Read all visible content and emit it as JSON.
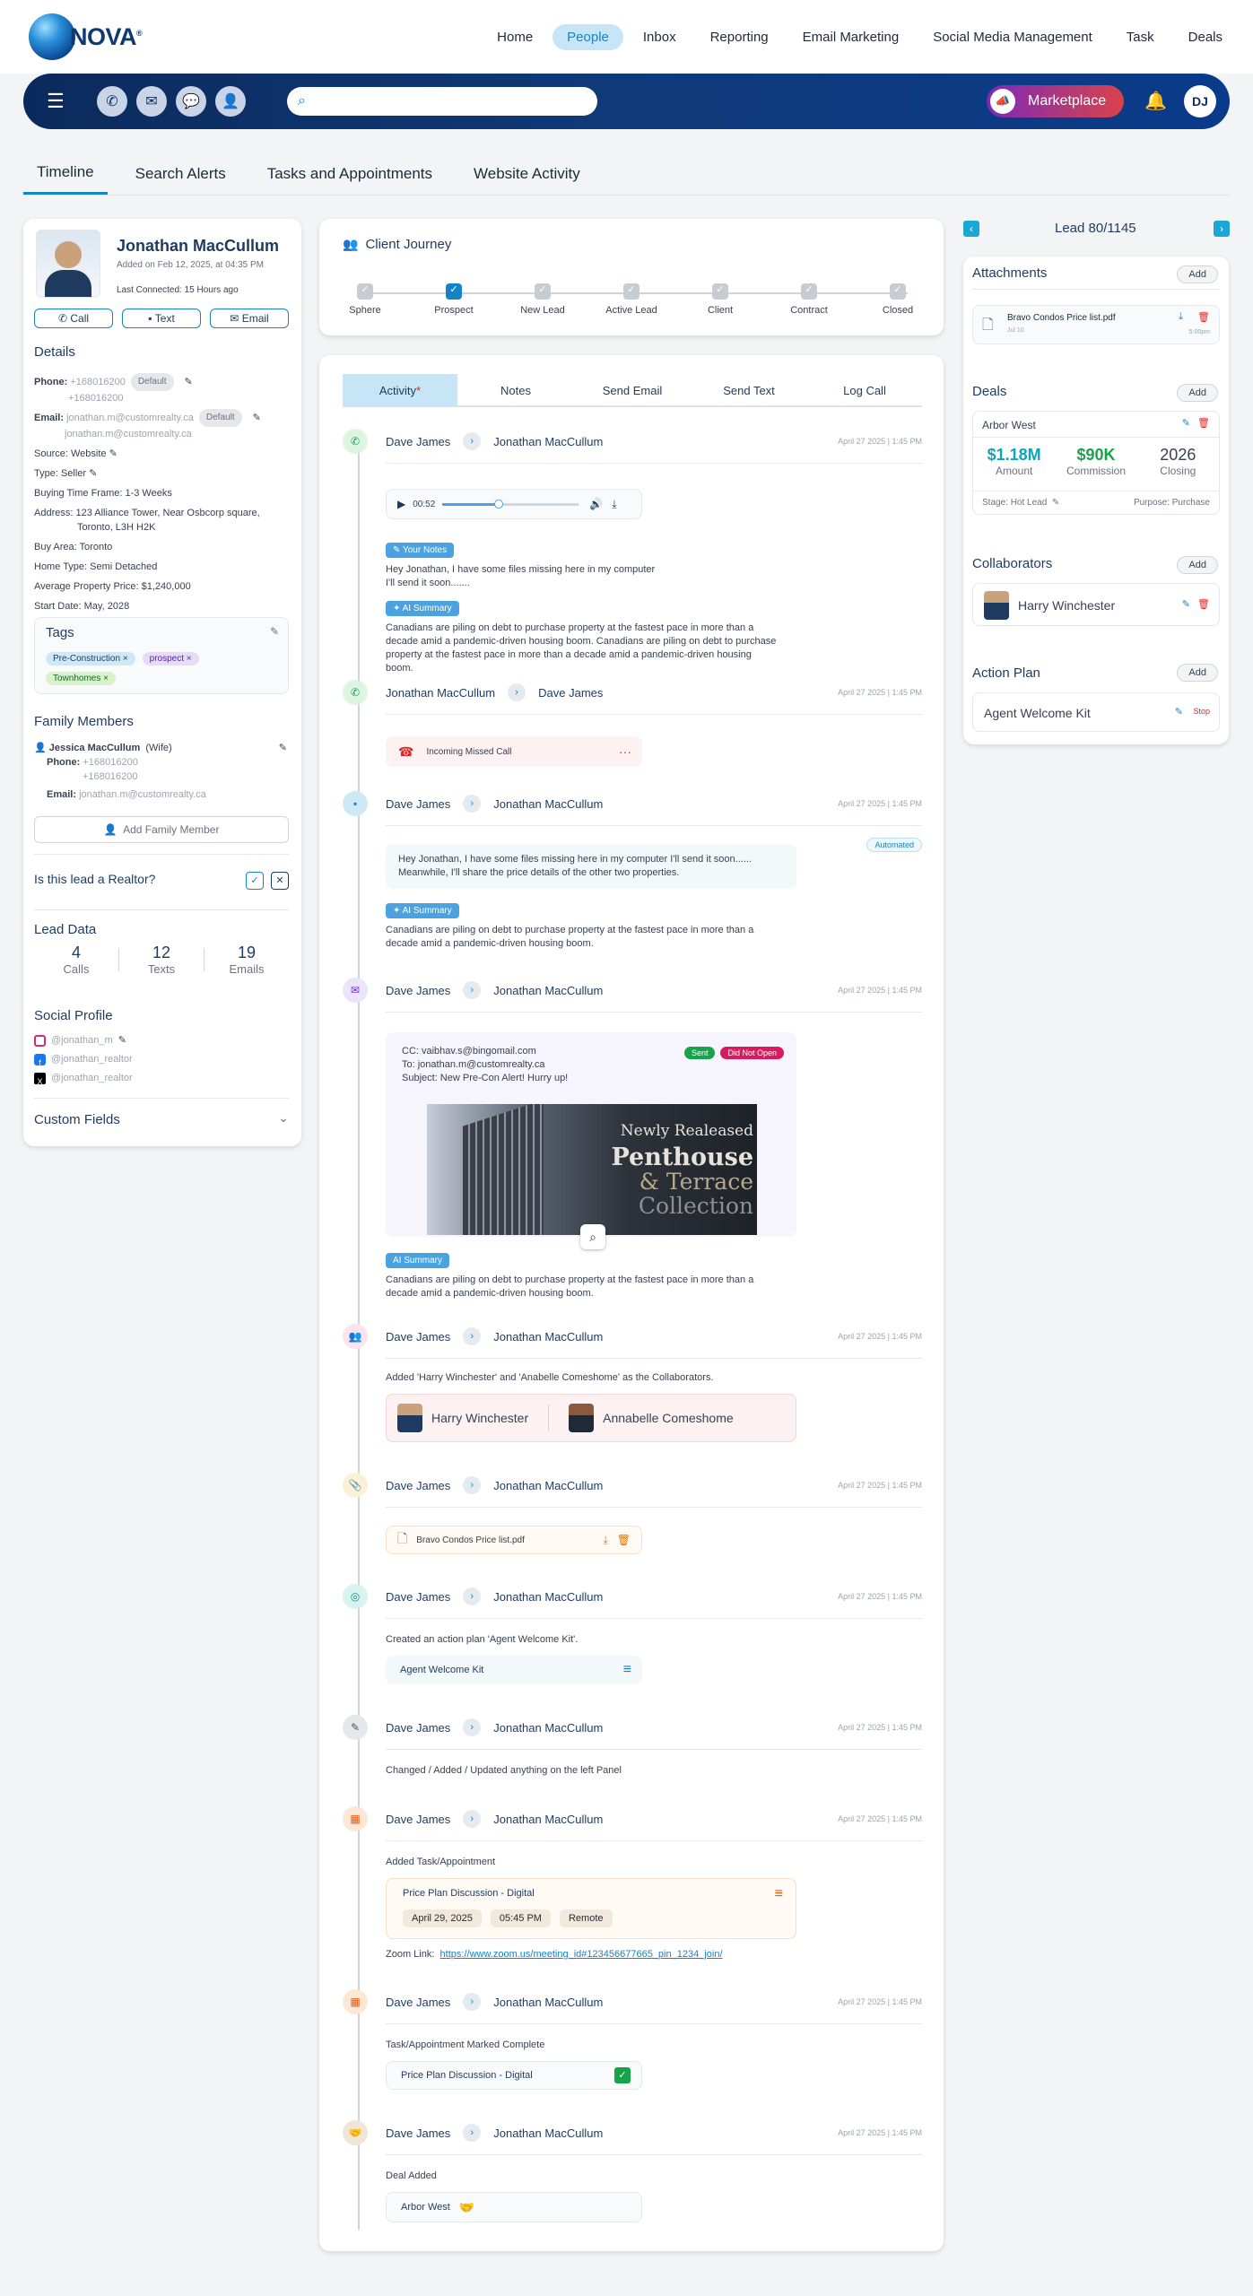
{
  "brand": {
    "name": "NOVA",
    "mark": "®"
  },
  "nav": [
    "Home",
    "People",
    "Inbox",
    "Reporting",
    "Email Marketing",
    "Social Media Management",
    "Task",
    "Deals"
  ],
  "nav_active": "People",
  "toolbar": {
    "marketplace": "Marketplace",
    "user_initials": "DJ",
    "search_placeholder": ""
  },
  "tabs": [
    "Timeline",
    "Search Alerts",
    "Tasks and Appointments",
    "Website Activity"
  ],
  "profile": {
    "name": "Jonathan MacCullum",
    "added": "Added on Feb 12, 2025, at 04:35 PM",
    "last": "Last Connected: 15 Hours ago",
    "actions": [
      "Call",
      "Text",
      "Email"
    ],
    "details_title": "Details",
    "phone_label": "Phone:",
    "phone1": "+168016200",
    "phone2": "+168016200",
    "default": "Default",
    "email_label": "Email:",
    "email1": "jonathan.m@customrealty.ca",
    "email2": "jonathan.m@customrealty.ca",
    "source": "Source: Website",
    "type": "Type: Seller",
    "btf": "Buying Time Frame: 1-3 Weeks",
    "address1": "Address: 123 Alliance Tower, Near Osbcorp square,",
    "address2": "Toronto, L3H H2K",
    "area": "Buy Area: Toronto",
    "home": "Home Type: Semi Detached",
    "avg": "Average Property Price: $1,240,000",
    "start": "Start Date: May, 2028",
    "tags_title": "Tags",
    "tags": [
      "Pre-Construction",
      "prospect",
      "Townhomes"
    ],
    "family_title": "Family Members",
    "fam_name": "Jessica MacCullum",
    "fam_rel": "(Wife)",
    "fam_phone_label": "Phone:",
    "fam_phone1": "+168016200",
    "fam_phone2": "+168016200",
    "fam_email_label": "Email:",
    "fam_email": "jonathan.m@customrealty.ca",
    "add_family": "Add Family Member",
    "realtor": "Is this lead a Realtor?",
    "lead_data": "Lead Data",
    "stats": [
      {
        "n": "4",
        "l": "Calls"
      },
      {
        "n": "12",
        "l": "Texts"
      },
      {
        "n": "19",
        "l": "Emails"
      }
    ],
    "social_title": "Social Profile",
    "social": [
      "@jonathan_m",
      "@jonathan_realtor",
      "@jonathan_realtor"
    ],
    "custom": "Custom Fields"
  },
  "journey": {
    "title": "Client Journey",
    "steps": [
      "Sphere",
      "Prospect",
      "New Lead",
      "Active Lead",
      "Client",
      "Contract",
      "Closed"
    ]
  },
  "activity_tabs": [
    "Activity",
    "Notes",
    "Send Email",
    "Send Text",
    "Log Call"
  ],
  "tl": {
    "from": "Dave James",
    "to": "Jonathan MacCullum",
    "date": "April 27 2025  |  1:45 PM",
    "audio_time": "00:52",
    "your_notes": "Your Notes",
    "note1": "Hey Jonathan, I have some files missing here in my computer",
    "note2": "I'll send it soon.......",
    "ai": "AI Summary",
    "summary1": "Canadians are piling on debt to purchase property at the fastest pace in more than a decade amid a pandemic-driven housing boom. Canadians are piling on debt to purchase property at the fastest pace in more than a decade amid a pandemic-driven housing boom.",
    "missed": "Incoming Missed Call",
    "automated": "Automated",
    "sms": "Hey Jonathan, I have some files missing here in my computer I'll send it soon...... Meanwhile, I'll share the price details of the other two properties.",
    "summary2": "Canadians are piling on debt to purchase property at the fastest pace in more than a decade amid a pandemic-driven housing boom.",
    "cc": "CC: vaibhav.s@bingomail.com",
    "tomail": "To: jonathan.m@customrealty.ca",
    "subject": "Subject: New Pre-Con Alert! Hurry up!",
    "sent": "Sent",
    "notopen": "Did Not Open",
    "promo1": "Newly Realeased",
    "promo2": "Penthouse",
    "promo3": "& Terrace",
    "promo4": "Collection",
    "collab_text": "Added 'Harry Winchester' and 'Anabelle Comeshome' as the Collaborators.",
    "collab1": "Harry Winchester",
    "collab2": "Annabelle Comeshome",
    "file": "Bravo Condos Price list.pdf",
    "plan_text": "Created an action plan 'Agent Welcome Kit'.",
    "plan": "Agent Welcome Kit",
    "changed": "Changed / Added / Updated anything on the left Panel",
    "task_added": "Added Task/Appointment",
    "task": "Price Plan Discussion - Digital",
    "task_date": "April 29, 2025",
    "task_time": "05:45 PM",
    "task_mode": "Remote",
    "zoom_label": "Zoom Link:",
    "zoom": "https://www.zoom.us/meeting_id#123456677665_pin_1234_join/",
    "complete": "Task/Appointment Marked Complete",
    "deal_added": "Deal Added",
    "deal": "Arbor West"
  },
  "right": {
    "lead": "Lead 80/1145",
    "add": "Add",
    "attachments": "Attachments",
    "att_file": "Bravo Condos Price list.pdf",
    "att_date": "Jul 10",
    "att_time": "5:00pm",
    "deals": "Deals",
    "deal_name": "Arbor West",
    "amount": "$1.18M",
    "amount_l": "Amount",
    "comm": "$90K",
    "comm_l": "Commission",
    "closing": "2026",
    "closing_l": "Closing",
    "stage": "Stage: Hot Lead",
    "purpose": "Purpose: Purchase",
    "collabs": "Collaborators",
    "collab": "Harry Winchester",
    "plan": "Action Plan",
    "plan_name": "Agent Welcome Kit",
    "stop": "Stop"
  },
  "colors": {
    "accent": "#1583c7",
    "navy": "#0b2a5c",
    "green": "#16a34a",
    "red": "#dc2626"
  }
}
